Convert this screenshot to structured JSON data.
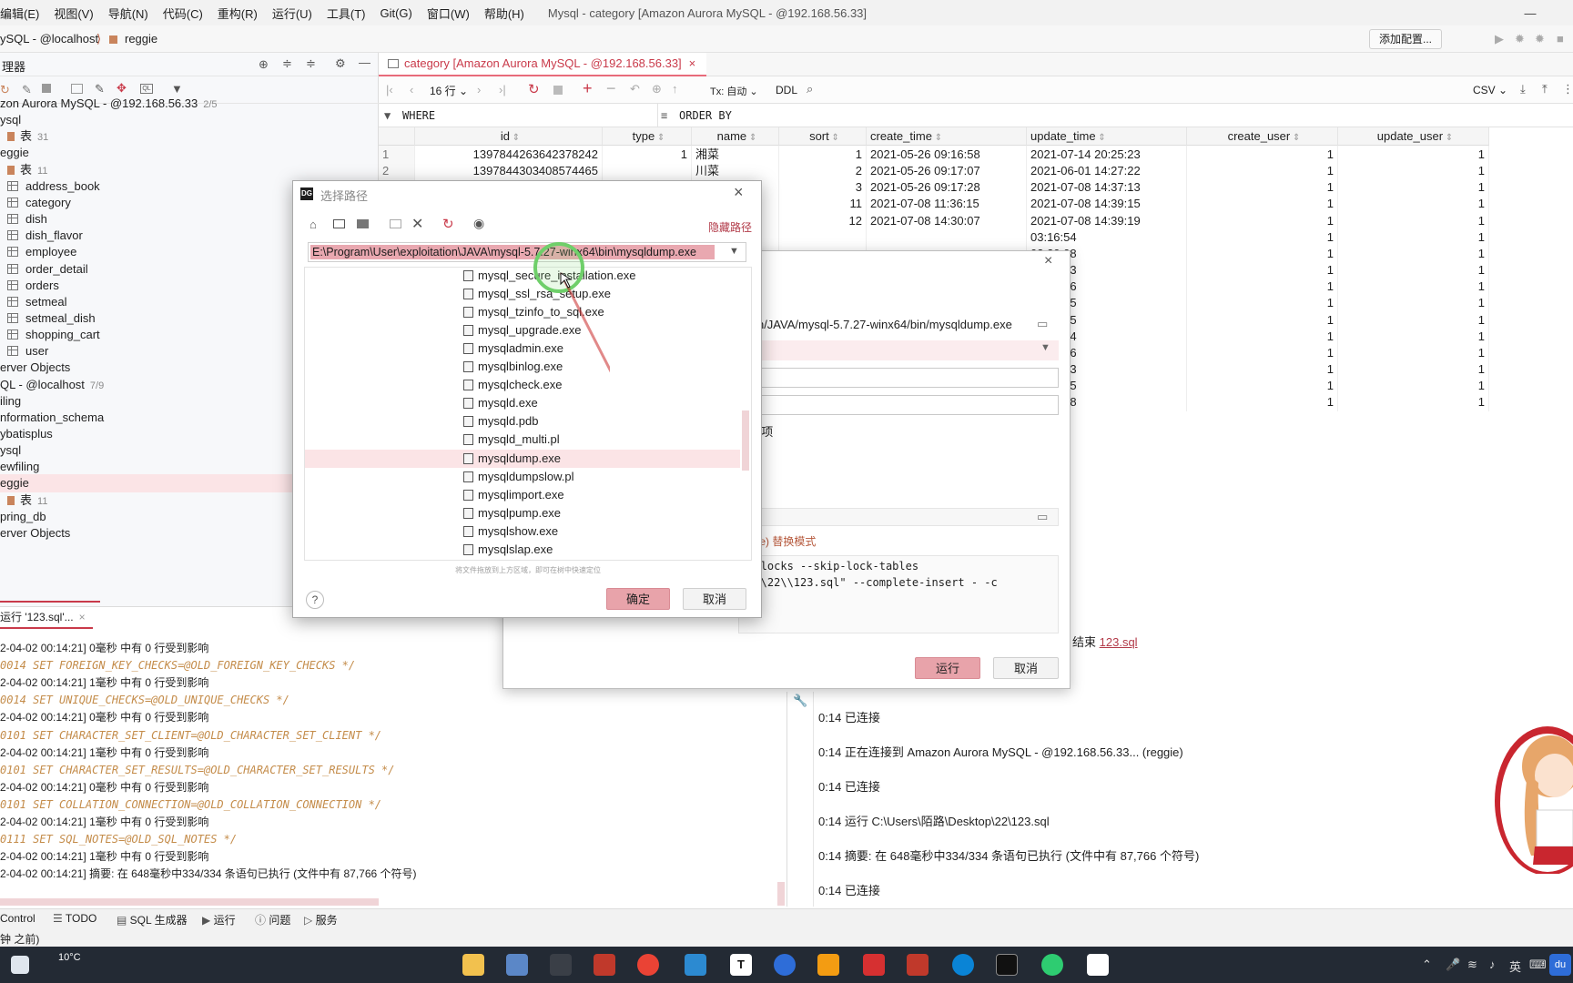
{
  "menu": {
    "items": [
      "编辑(E)",
      "视图(V)",
      "导航(N)",
      "代码(C)",
      "重构(R)",
      "运行(U)",
      "工具(T)",
      "Git(G)",
      "窗口(W)",
      "帮助(H)"
    ],
    "window_title": "Mysql - category [Amazon Aurora MySQL - @192.168.56.33]"
  },
  "nav": {
    "crumb1": "ySQL - @localhost",
    "crumb2": "reggie",
    "add_config": "添加配置..."
  },
  "left": {
    "title": "理器",
    "tree": [
      {
        "label": "zon Aurora MySQL - @192.168.56.33",
        "count": "2/5",
        "kind": "plain"
      },
      {
        "label": "ysql",
        "count": "",
        "kind": "plain"
      },
      {
        "label": "表",
        "count": "31",
        "kind": "folder"
      },
      {
        "label": "eggie",
        "count": "",
        "kind": "plain"
      },
      {
        "label": "表",
        "count": "11",
        "kind": "folder"
      },
      {
        "label": "address_book",
        "count": "",
        "kind": "table"
      },
      {
        "label": "category",
        "count": "",
        "kind": "table"
      },
      {
        "label": "dish",
        "count": "",
        "kind": "table"
      },
      {
        "label": "dish_flavor",
        "count": "",
        "kind": "table"
      },
      {
        "label": "employee",
        "count": "",
        "kind": "table"
      },
      {
        "label": "order_detail",
        "count": "",
        "kind": "table"
      },
      {
        "label": "orders",
        "count": "",
        "kind": "table"
      },
      {
        "label": "setmeal",
        "count": "",
        "kind": "table"
      },
      {
        "label": "setmeal_dish",
        "count": "",
        "kind": "table"
      },
      {
        "label": "shopping_cart",
        "count": "",
        "kind": "table"
      },
      {
        "label": "user",
        "count": "",
        "kind": "table"
      },
      {
        "label": "erver Objects",
        "count": "",
        "kind": "plain"
      },
      {
        "label": "QL - @localhost",
        "count": "7/9",
        "kind": "plain"
      },
      {
        "label": "iling",
        "count": "",
        "kind": "plain"
      },
      {
        "label": "nformation_schema",
        "count": "",
        "kind": "plain"
      },
      {
        "label": "ybatisplus",
        "count": "",
        "kind": "plain"
      },
      {
        "label": "ysql",
        "count": "",
        "kind": "plain"
      },
      {
        "label": "ewfiling",
        "count": "",
        "kind": "plain"
      },
      {
        "label": "eggie",
        "count": "",
        "kind": "plain",
        "selected": true
      },
      {
        "label": "表",
        "count": "11",
        "kind": "folder"
      },
      {
        "label": "pring_db",
        "count": "",
        "kind": "plain"
      },
      {
        "label": "erver Objects",
        "count": "",
        "kind": "plain"
      }
    ]
  },
  "editor": {
    "tab": "category [Amazon Aurora MySQL - @192.168.56.33]",
    "rows_label": "16 行",
    "tx_label": "Tx: 自动",
    "ddl": "DDL",
    "csv": "CSV",
    "where": "WHERE",
    "order_by": "ORDER BY",
    "columns": [
      "id",
      "type",
      "name",
      "sort",
      "create_time",
      "update_time",
      "create_user",
      "update_user"
    ],
    "rows": [
      {
        "n": "1",
        "id": "1397844263642378242",
        "type": "1",
        "name": "湘菜",
        "sort": "1",
        "create_time": "2021-05-26 09:16:58",
        "update_time": "2021-07-14 20:25:23",
        "create_user": "1",
        "update_user": "1"
      },
      {
        "n": "2",
        "id": "1397844303408574465",
        "type": "",
        "name": "川菜",
        "sort": "2",
        "create_time": "2021-05-26 09:17:07",
        "update_time": "2021-06-01 14:27:22",
        "create_user": "1",
        "update_user": "1"
      },
      {
        "n": "",
        "id": "",
        "type": "",
        "name": "",
        "sort": "3",
        "create_time": "2021-05-26 09:17:28",
        "update_time": "2021-07-08 14:37:13",
        "create_user": "1",
        "update_user": "1"
      },
      {
        "n": "",
        "id": "",
        "type": "",
        "name": "",
        "sort": "11",
        "create_time": "2021-07-08 11:36:15",
        "update_time": "2021-07-08 14:39:15",
        "create_user": "1",
        "update_user": "1"
      },
      {
        "n": "",
        "id": "",
        "type": "",
        "name": "",
        "sort": "12",
        "create_time": "2021-07-08 14:30:07",
        "update_time": "2021-07-08 14:39:19",
        "create_user": "1",
        "update_user": "1"
      },
      {
        "n": "",
        "id": "",
        "type": "",
        "name": "",
        "sort": "",
        "create_time": "",
        "update_time": "03:16:54",
        "create_user": "1",
        "update_user": "1"
      },
      {
        "n": "",
        "id": "",
        "type": "",
        "name": "",
        "sort": "",
        "create_time": "",
        "update_time": "03:20:08",
        "create_user": "1",
        "update_user": "1"
      },
      {
        "n": "",
        "id": "",
        "type": "",
        "name": "",
        "sort": "",
        "create_time": "",
        "update_time": "04:08:33",
        "create_user": "1",
        "update_user": "1"
      },
      {
        "n": "",
        "id": "",
        "type": "",
        "name": "",
        "sort": "",
        "create_time": "",
        "update_time": "04:09:36",
        "create_user": "1",
        "update_user": "1"
      },
      {
        "n": "",
        "id": "",
        "type": "",
        "name": "",
        "sort": "",
        "create_time": "",
        "update_time": "07:33:25",
        "create_user": "1",
        "update_user": "1"
      },
      {
        "n": "",
        "id": "",
        "type": "",
        "name": "",
        "sort": "",
        "create_time": "",
        "update_time": "00:21:25",
        "create_user": "1",
        "update_user": "1"
      },
      {
        "n": "",
        "id": "",
        "type": "",
        "name": "",
        "sort": "",
        "create_time": "",
        "update_time": "00:17:34",
        "create_user": "1",
        "update_user": "1"
      },
      {
        "n": "",
        "id": "",
        "type": "",
        "name": "",
        "sort": "",
        "create_time": "",
        "update_time": "00:17:56",
        "create_user": "1",
        "update_user": "1"
      },
      {
        "n": "",
        "id": "",
        "type": "",
        "name": "",
        "sort": "",
        "create_time": "",
        "update_time": "00:19:13",
        "create_user": "1",
        "update_user": "1"
      },
      {
        "n": "",
        "id": "",
        "type": "",
        "name": "",
        "sort": "",
        "create_time": "",
        "update_time": "00:19:25",
        "create_user": "1",
        "update_user": "1"
      },
      {
        "n": "",
        "id": "",
        "type": "",
        "name": "",
        "sort": "",
        "create_time": "",
        "update_time": "08:00:28",
        "create_user": "1",
        "update_user": "1"
      }
    ]
  },
  "run": {
    "tab": "运行 '123.sql'...",
    "lines": [
      {
        "t": "2-04-02 00:14:21] 0毫秒 中有 0 行受到影响",
        "c": false
      },
      {
        "t": "0014 SET FOREIGN_KEY_CHECKS=@OLD_FOREIGN_KEY_CHECKS */",
        "c": true
      },
      {
        "t": "2-04-02 00:14:21] 1毫秒 中有 0 行受到影响",
        "c": false
      },
      {
        "t": "0014 SET UNIQUE_CHECKS=@OLD_UNIQUE_CHECKS */",
        "c": true
      },
      {
        "t": "2-04-02 00:14:21] 0毫秒 中有 0 行受到影响",
        "c": false
      },
      {
        "t": "0101 SET CHARACTER_SET_CLIENT=@OLD_CHARACTER_SET_CLIENT */",
        "c": true
      },
      {
        "t": "2-04-02 00:14:21] 1毫秒 中有 0 行受到影响",
        "c": false
      },
      {
        "t": "0101 SET CHARACTER_SET_RESULTS=@OLD_CHARACTER_SET_RESULTS */",
        "c": true
      },
      {
        "t": "2-04-02 00:14:21] 0毫秒 中有 0 行受到影响",
        "c": false
      },
      {
        "t": "0101 SET COLLATION_CONNECTION=@OLD_COLLATION_CONNECTION */",
        "c": true
      },
      {
        "t": "2-04-02 00:14:21] 1毫秒 中有 0 行受到影响",
        "c": false
      },
      {
        "t": "0111 SET SQL_NOTES=@OLD_SQL_NOTES */",
        "c": true
      },
      {
        "t": "2-04-02 00:14:21] 1毫秒 中有 0 行受到影响",
        "c": false
      },
      {
        "t": "2-04-02 00:14:21] 摘要: 在 648毫秒中334/334 条语句已执行 (文件中有 87,766 个符号)",
        "c": false
      }
    ]
  },
  "services": {
    "end_text": "结束",
    "end_link": "123.sql",
    "lines": [
      "0:14  已连接",
      "0:14  正在连接到 Amazon Aurora MySQL - @192.168.56.33... (reggie)",
      "0:14  已连接",
      "0:14  运行 C:\\Users\\陌路\\Desktop\\22\\123.sql",
      "0:14  摘要: 在 648毫秒中334/334 条语句已执行 (文件中有 87,766 个符号)",
      "0:14  已连接"
    ]
  },
  "dump": {
    "path_tail": "ation/JAVA/mysql-5.7.27-winx64/bin/mysqldump.exe",
    "option_label": "E 选项",
    "mode_label": "ource) 替换模式",
    "cmd_line1": "dd-locks --skip-lock-tables",
    "cmd_line2": "op\\\\22\\\\123.sql\" --complete-insert - -c",
    "run_btn": "运行",
    "cancel_btn": "取消"
  },
  "chooser": {
    "title": "选择路径",
    "hide_path": "隐藏路径",
    "path": "E:\\Program\\User\\exploitation\\JAVA\\mysql-5.7.27-winx64\\bin\\mysqldump.exe",
    "files": [
      "mysql_secure_installation.exe",
      "mysql_ssl_rsa_setup.exe",
      "mysql_tzinfo_to_sql.exe",
      "mysql_upgrade.exe",
      "mysqladmin.exe",
      "mysqlbinlog.exe",
      "mysqlcheck.exe",
      "mysqld.exe",
      "mysqld.pdb",
      "mysqld_multi.pl",
      "mysqldump.exe",
      "mysqldumpslow.pl",
      "mysqlimport.exe",
      "mysqlpump.exe",
      "mysqlshow.exe",
      "mysqlslap.exe"
    ],
    "selected_file": "mysqldump.exe",
    "hint": "将文件拖放到上方区域，即可在树中快速定位",
    "ok": "确定",
    "cancel": "取消",
    "help": "?"
  },
  "bottom_tools": [
    "Control",
    "TODO",
    "SQL 生成器",
    "运行",
    "问题",
    "服务"
  ],
  "status": "钟 之前)",
  "taskbar": {
    "weather": "10°C",
    "ime": "英",
    "du": "du"
  },
  "colors": {
    "accent": "#e86b7a",
    "selection": "#fbe4e6",
    "comment": "#c48c4a",
    "taskbar": "#232a34"
  }
}
